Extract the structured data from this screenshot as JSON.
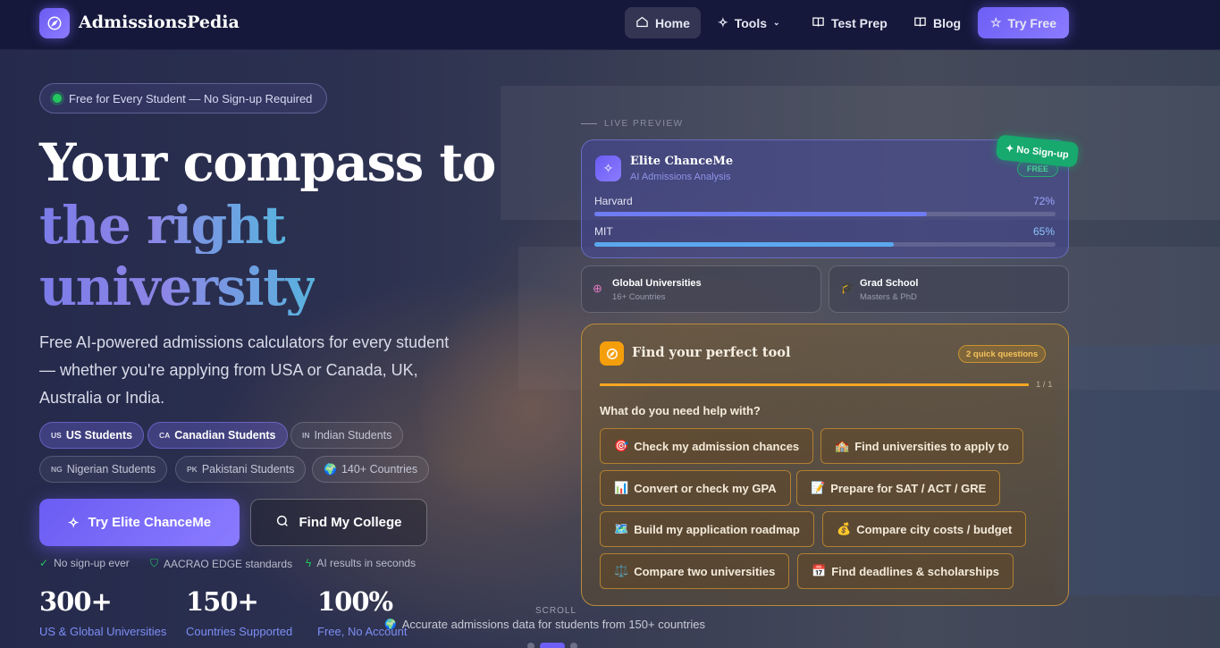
{
  "nav": {
    "brand": "AdmissionsPedia",
    "items": [
      {
        "label": "Home",
        "icon": "home-icon"
      },
      {
        "label": "Tools",
        "icon": "sparkle-icon"
      },
      {
        "label": "Test Prep",
        "icon": "book-icon"
      },
      {
        "label": "Blog",
        "icon": "book-icon"
      }
    ],
    "cta": "Try Free"
  },
  "hero": {
    "badge": "Free for Every Student — No Sign-up Required",
    "title_line1": "Your compass to",
    "title_line2": "the right",
    "title_line3": "university",
    "description": "Free AI-powered admissions calculators for every student — whether you're applying from USA or Canada, UK, Australia or India.",
    "audiences": [
      {
        "code": "US",
        "label": "US Students"
      },
      {
        "code": "CA",
        "label": "Canadian Students"
      },
      {
        "code": "IN",
        "label": "Indian Students"
      },
      {
        "code": "NG",
        "label": "Nigerian Students"
      },
      {
        "code": "PK",
        "label": "Pakistani Students"
      },
      {
        "code": "🌍",
        "label": "140+ Countries"
      }
    ],
    "primary_cta": "Try Elite ChanceMe",
    "secondary_cta": "Find My College",
    "trust": [
      "No sign-up ever",
      "AACRAO EDGE standards",
      "AI results in seconds"
    ],
    "stats": [
      {
        "value": "300+",
        "label": "US & Global Universities"
      },
      {
        "value": "150+",
        "label": "Countries Supported"
      },
      {
        "value": "100%",
        "label": "Free, No Account"
      }
    ],
    "scroll": "SCROLL",
    "ticker": "Accurate admissions data for students from 150+ countries"
  },
  "preview": {
    "label": "LIVE PREVIEW",
    "ribbon": "✦ No Sign-up",
    "card_title": "Elite ChanceMe",
    "card_subtitle": "AI Admissions Analysis",
    "card_badge": "FREE",
    "schools": [
      {
        "name": "Harvard",
        "pct_text": "72%",
        "pct": 72,
        "color": "#6f7cf2"
      },
      {
        "name": "MIT",
        "pct_text": "65%",
        "pct": 65,
        "color": "#5aa8ee"
      }
    ],
    "mini": [
      {
        "title": "Global Universities",
        "subtitle": "16+ Countries",
        "icon": "globe-icon"
      },
      {
        "title": "Grad School",
        "subtitle": "Masters & PhD",
        "icon": "grad-cap-icon"
      }
    ]
  },
  "finder": {
    "title": "Find your perfect tool",
    "badge": "2 quick questions",
    "step": "1 / 1",
    "progress": 1.0,
    "question": "What do you need help with?",
    "options": [
      {
        "emoji": "🎯",
        "label": "Check my admission chances"
      },
      {
        "emoji": "🏫",
        "label": "Find universities to apply to"
      },
      {
        "emoji": "📊",
        "label": "Convert or check my GPA"
      },
      {
        "emoji": "📝",
        "label": "Prepare for SAT / ACT / GRE"
      },
      {
        "emoji": "🗺️",
        "label": "Build my application roadmap"
      },
      {
        "emoji": "💰",
        "label": "Compare city costs / budget"
      },
      {
        "emoji": "⚖️",
        "label": "Compare two universities"
      },
      {
        "emoji": "📅",
        "label": "Find deadlines & scholarships"
      }
    ]
  },
  "colors": {
    "accent": "#6d5ff5",
    "gold": "#b98a3a",
    "green": "#17a96e"
  }
}
